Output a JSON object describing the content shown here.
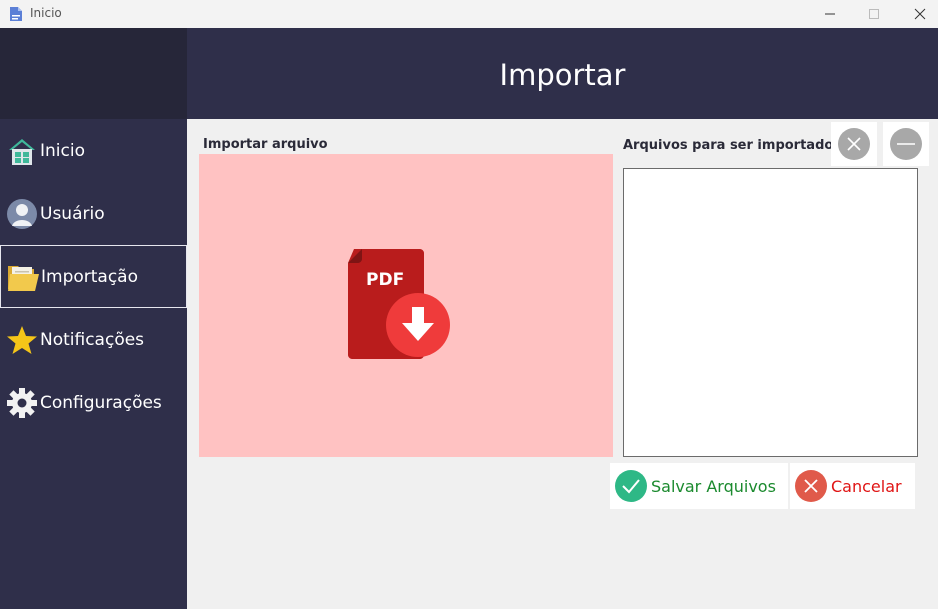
{
  "window": {
    "title": "Inicio"
  },
  "header": {
    "title": "Importar"
  },
  "sidebar": {
    "items": [
      {
        "label": "Inicio",
        "icon": "home-icon"
      },
      {
        "label": "Usuário",
        "icon": "user-icon"
      },
      {
        "label": "Importação",
        "icon": "folder-icon",
        "active": true
      },
      {
        "label": "Notificações",
        "icon": "star-icon"
      },
      {
        "label": "Configurações",
        "icon": "gear-icon"
      }
    ]
  },
  "import": {
    "label": "Importar arquivo",
    "pdf_badge": "PDF"
  },
  "files": {
    "label": "Arquivos para ser importado",
    "items": []
  },
  "actions": {
    "save_label": "Salvar Arquivos",
    "cancel_label": "Cancelar"
  },
  "colors": {
    "sidebar": "#2f2f4a",
    "drop_zone": "#ffc2c2",
    "save": "#1b8a2e",
    "save_icon": "#2eb886",
    "cancel": "#e01414",
    "cancel_icon": "#e05a4a"
  }
}
